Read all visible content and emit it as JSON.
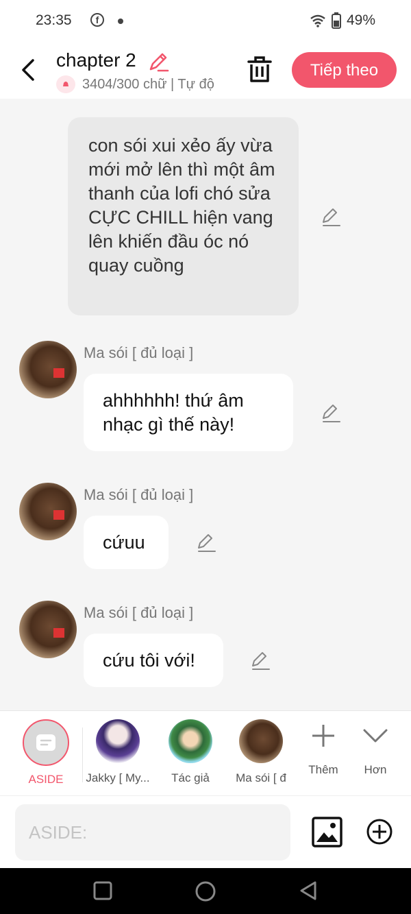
{
  "status_bar": {
    "time": "23:35",
    "battery": "49%"
  },
  "header": {
    "title": "chapter 2",
    "subtitle": "3404/300 chữ | Tự độ",
    "next_label": "Tiếp theo"
  },
  "narration": {
    "text": "con sói xui xẻo ấy vừa mới mở lên thì một âm thanh của lofi chó sửa CỰC CHILL hiện vang lên khiến đầu óc nó quay cuồng"
  },
  "messages": [
    {
      "sender": "Ma sói [ đủ loại ]",
      "text": "ahhhhhh! thứ âm nhạc gì thế này!"
    },
    {
      "sender": "Ma sói [ đủ loại ]",
      "text": "cứuu"
    },
    {
      "sender": "Ma sói [ đủ loại ]",
      "text": "cứu tôi với!"
    }
  ],
  "characters": {
    "aside": "ASIDE",
    "jakky": "Jakky [ My...",
    "author": "Tác giả",
    "masoi": "Ma sói [ đ",
    "more": "Thêm",
    "less": "Hơn"
  },
  "input": {
    "placeholder": "ASIDE:"
  },
  "colors": {
    "accent": "#f2566c",
    "bubble": "#ffffff",
    "narration_bg": "#e9e9e9"
  }
}
